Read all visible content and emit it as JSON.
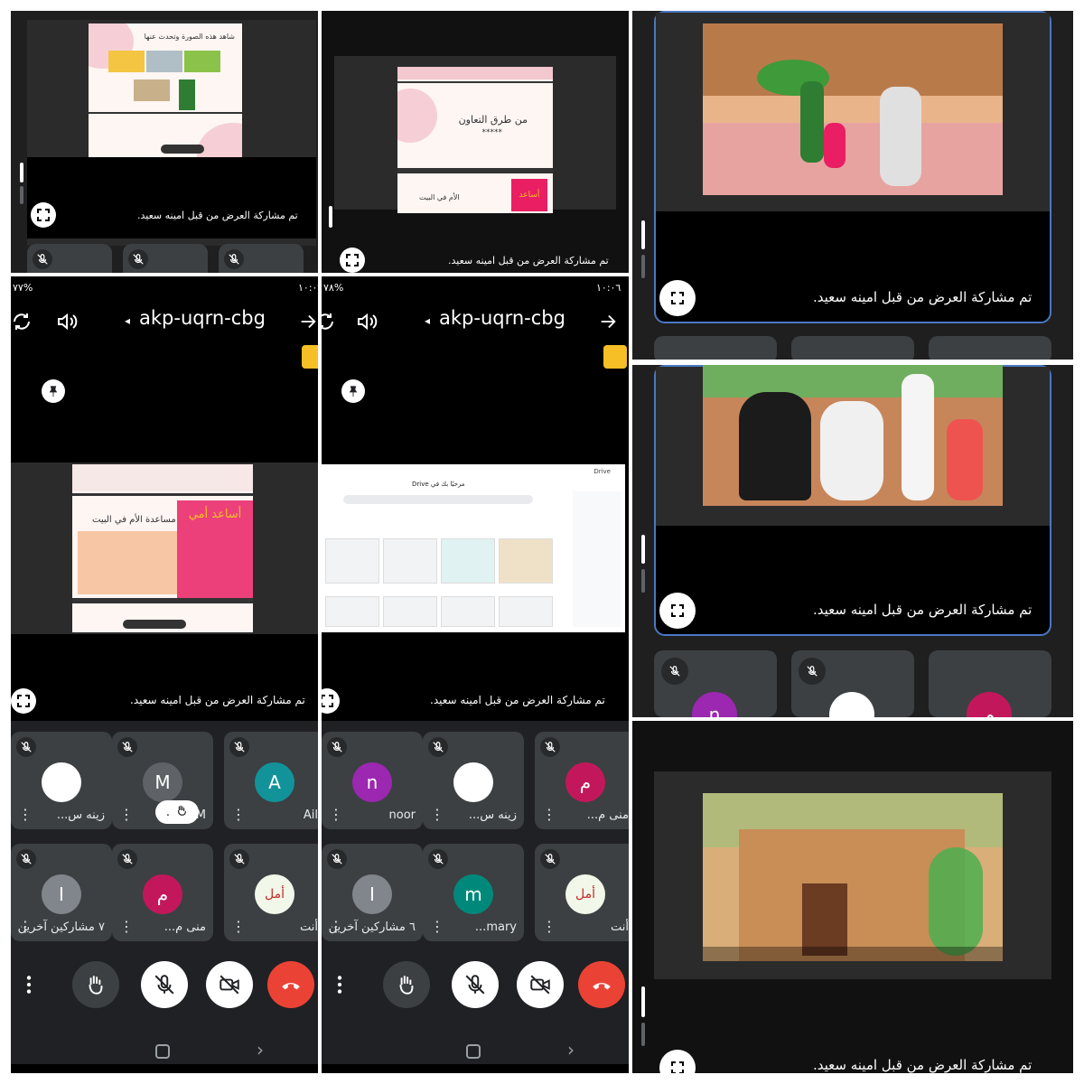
{
  "meeting": {
    "code": "akp-uqrn-cbg",
    "presenting_caption": "تم مشاركة العرض من قبل امينه سعيد."
  },
  "status_bar": {
    "left": {
      "battery": "٧٧%",
      "time": "١٠:٠٦"
    },
    "middle": {
      "battery": "٧٨%",
      "time": "١٠:٠٦"
    }
  },
  "slides": {
    "p1_title": "شاهد هذه الصورة وتحدث عنها",
    "p2_title": "من طرق التعاون",
    "p2_stars": "*****",
    "p2_bottom": "الأم في البيت",
    "p2_book": "أساعد",
    "mid_left_title": "مساعدة الأم في البيت",
    "mid_left_book": "أساعد أمي"
  },
  "drive": {
    "brand": "Drive",
    "heading": "مرحبًا بك في Drive"
  },
  "left_phone": {
    "participants": [
      {
        "name": "زينه س...",
        "initial": "",
        "color": "#ffffff"
      },
      {
        "name": "M",
        "initial": "M",
        "color": "#5f6368"
      },
      {
        "name": "Ail",
        "initial": "A",
        "color": "#12939a"
      },
      {
        "name": "٧ مشاركين آخرين",
        "initial": "I",
        "color": "#80868b"
      },
      {
        "name": "منى م...",
        "initial": "م",
        "color": "#c2185b"
      },
      {
        "name": "أنت",
        "initial": "أمل",
        "color": "#f1f8e9"
      }
    ],
    "hand_label": "."
  },
  "mid_phone": {
    "participants": [
      {
        "name": "noor",
        "initial": "n",
        "color": "#9c27b0"
      },
      {
        "name": "زينه س...",
        "initial": "",
        "color": "#ffffff"
      },
      {
        "name": "منى م...",
        "initial": "م",
        "color": "#c2185b"
      },
      {
        "name": "٦ مشاركين آخرين",
        "initial": "I",
        "color": "#80868b"
      },
      {
        "name": "mary...",
        "initial": "m",
        "color": "#00897b"
      },
      {
        "name": "أنت",
        "initial": "أمل",
        "color": "#f1f8e9"
      }
    ]
  },
  "right_panel_2_avatars": [
    {
      "initial": "n",
      "color": "#9c27b0"
    },
    {
      "initial": "",
      "color": "#ffffff"
    },
    {
      "initial": "م",
      "color": "#c2185b"
    }
  ],
  "icons": [
    "mic-off-icon",
    "camera-off-icon",
    "hang-up-icon",
    "raise-hand-icon",
    "more-icon",
    "rotate-icon",
    "speaker-icon",
    "pin-icon",
    "expand-icon"
  ],
  "colors": {
    "hangup": "#ea4335",
    "meet_bg": "#202124",
    "tile": "#3c4043",
    "accent_yellow": "#f6bf26"
  }
}
